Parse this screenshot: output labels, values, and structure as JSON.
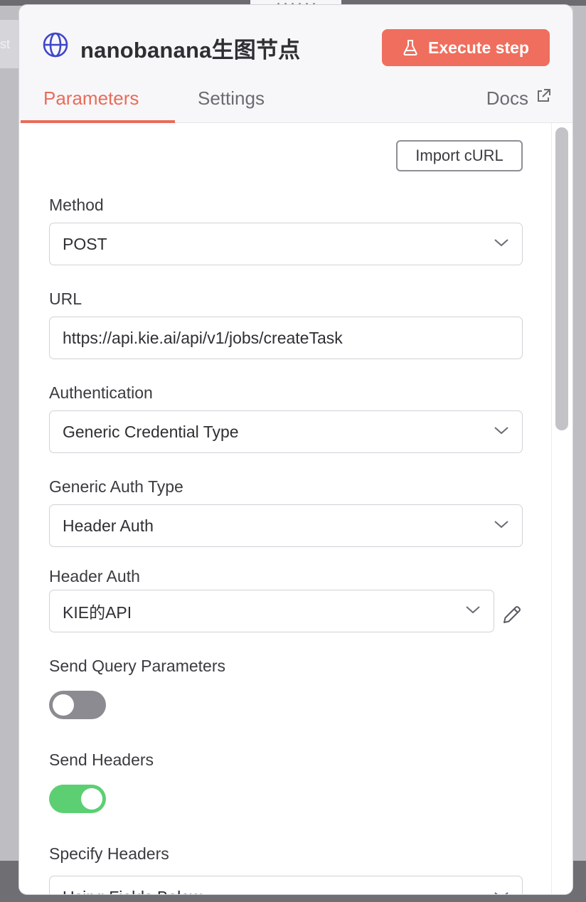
{
  "node_tab_text": "st",
  "header": {
    "title": "nanobanana生图节点",
    "execute_label": "Execute step"
  },
  "tabs": {
    "parameters": "Parameters",
    "settings": "Settings",
    "docs": "Docs",
    "active": "Parameters"
  },
  "import_curl_label": "Import cURL",
  "fields": {
    "method": {
      "label": "Method",
      "value": "POST"
    },
    "url": {
      "label": "URL",
      "value": "https://api.kie.ai/api/v1/jobs/createTask"
    },
    "authentication": {
      "label": "Authentication",
      "value": "Generic Credential Type"
    },
    "generic_auth_type": {
      "label": "Generic Auth Type",
      "value": "Header Auth"
    },
    "header_auth": {
      "label": "Header Auth",
      "value": "KIE的API"
    },
    "send_query": {
      "label": "Send Query Parameters",
      "enabled": false
    },
    "send_headers": {
      "label": "Send Headers",
      "enabled": true
    },
    "specify_headers": {
      "label": "Specify Headers",
      "value": "Using Fields Below"
    }
  },
  "colors": {
    "accent": "#ef6e5d",
    "toggle_on": "#5ccf73",
    "toggle_off": "#8b8b91",
    "globe": "#3f46c9"
  },
  "icons": {
    "globe": "globe-icon",
    "flask": "flask-icon",
    "external_link": "external-link-icon",
    "chevron": "chevron-down-icon",
    "pencil": "pencil-icon"
  }
}
